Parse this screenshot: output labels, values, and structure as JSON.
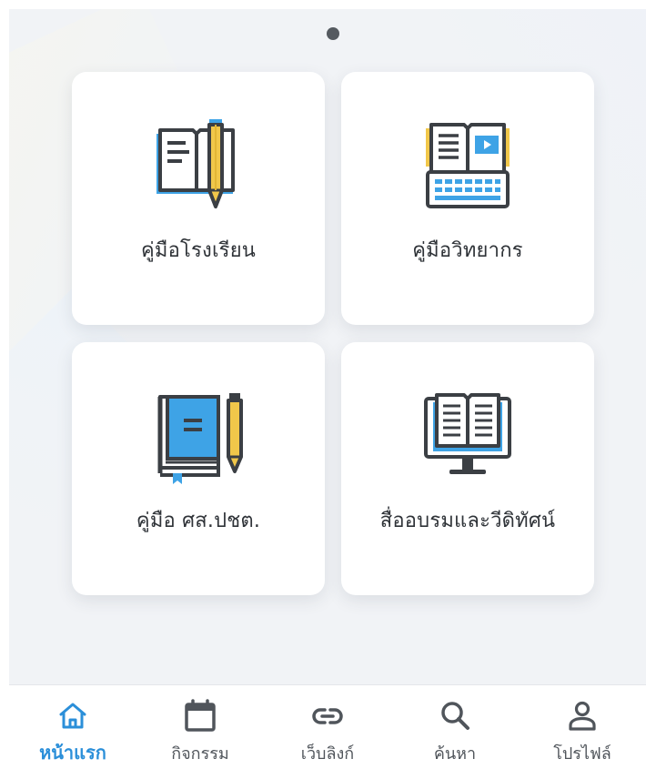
{
  "pager": {
    "pages": 1,
    "current": 1
  },
  "menu": {
    "items": [
      {
        "label": "คู่มือโรงเรียน",
        "icon": "open-book-pencil-icon"
      },
      {
        "label": "คู่มือวิทยากร",
        "icon": "ebook-keyboard-icon"
      },
      {
        "label": "คู่มือ ศส.ปชต.",
        "icon": "book-pencil-icon"
      },
      {
        "label": "สื่ออบรมและวีดิทัศน์",
        "icon": "monitor-book-icon"
      }
    ]
  },
  "tabbar": {
    "items": [
      {
        "label": "หน้าแรก",
        "icon": "home-icon",
        "active": true
      },
      {
        "label": "กิจกรรม",
        "icon": "calendar-icon",
        "active": false
      },
      {
        "label": "เว็บลิงก์",
        "icon": "link-icon",
        "active": false
      },
      {
        "label": "ค้นหา",
        "icon": "search-icon",
        "active": false
      },
      {
        "label": "โปรไฟล์",
        "icon": "profile-icon",
        "active": false
      }
    ]
  },
  "colors": {
    "accent": "#2b8fd9",
    "icon_dark": "#3b3f44",
    "icon_blue": "#3ea3e6",
    "icon_yellow": "#f1c74a",
    "background": "#f1f3f6",
    "card": "#ffffff"
  }
}
